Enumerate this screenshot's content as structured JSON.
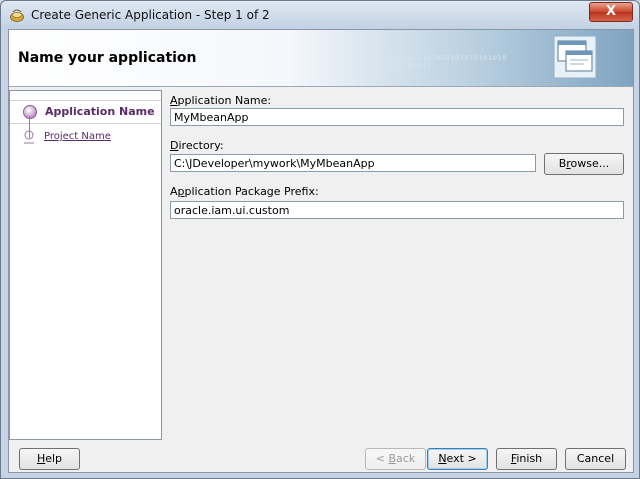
{
  "window": {
    "title": "Create Generic Application - Step 1 of 2",
    "close_glyph": "X"
  },
  "banner": {
    "title": "Name your application",
    "bits": "0101010101010101010101010\n010101010"
  },
  "steps": [
    {
      "label": "Application Name",
      "selected": true
    },
    {
      "label": "Project Name",
      "selected": false
    }
  ],
  "form": {
    "app_name_label_pre": "A",
    "app_name_label_rest": "pplication Name:",
    "app_name_value": "MyMbeanApp",
    "directory_label_pre": "D",
    "directory_label_rest": "irectory:",
    "directory_value": "C:\\JDeveloper\\mywork\\MyMbeanApp",
    "browse_pre": "B",
    "browse_u": "r",
    "browse_rest": "owse...",
    "prefix_label_pre": "A",
    "prefix_label_u": "p",
    "prefix_label_rest": "plication Package Prefix:",
    "prefix_value": "oracle.iam.ui.custom"
  },
  "buttons": {
    "help_u": "H",
    "help_rest": "elp",
    "back_pre": "< ",
    "back_u": "B",
    "back_rest": "ack",
    "next_u": "N",
    "next_rest": "ext >",
    "finish_u": "F",
    "finish_rest": "inish",
    "cancel": "Cancel"
  }
}
